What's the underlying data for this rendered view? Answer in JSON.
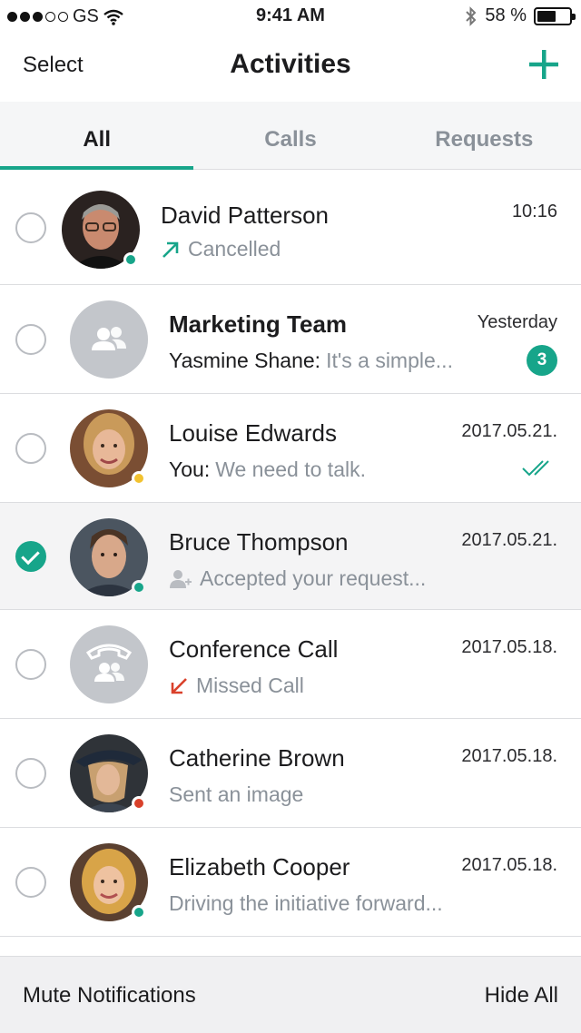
{
  "status_bar": {
    "carrier": "GS",
    "signal_dots_filled": 3,
    "signal_dots_total": 5,
    "time": "9:41 AM",
    "battery": "58 %",
    "battery_level": 0.58,
    "icons": [
      "wifi-icon",
      "bluetooth-icon",
      "battery-icon"
    ]
  },
  "nav": {
    "select_label": "Select",
    "title": "Activities",
    "add_icon": "plus-icon"
  },
  "tabs": [
    {
      "label": "All",
      "active": true
    },
    {
      "label": "Calls",
      "active": false
    },
    {
      "label": "Requests",
      "active": false
    }
  ],
  "colors": {
    "accent": "#17a58a",
    "online": "#17a58a",
    "away": "#f2c230",
    "busy": "#d9412b",
    "missed": "#d9412b"
  },
  "activities": [
    {
      "name": "David Patterson",
      "time": "10:16",
      "status_icon": "outgoing-arrow-icon",
      "status_text": "Cancelled",
      "presence": "online",
      "selected": false
    },
    {
      "name": "Marketing Team",
      "time": "Yesterday",
      "sender": "Yasmine Shane:",
      "message": "It's a simple...",
      "unread": "3",
      "group": true,
      "selected": false
    },
    {
      "name": "Louise Edwards",
      "time": "2017.05.21.",
      "sender": "You:",
      "message": "We need to talk.",
      "read_icon": "double-check-icon",
      "presence": "away",
      "selected": false
    },
    {
      "name": "Bruce Thompson",
      "time": "2017.05.21.",
      "status_icon": "add-contact-icon",
      "status_text": "Accepted your request...",
      "presence": "online",
      "selected": true
    },
    {
      "name": "Conference Call",
      "time": "2017.05.18.",
      "status_icon": "missed-call-arrow-icon",
      "status_text": "Missed Call",
      "group": true,
      "selected": false
    },
    {
      "name": "Catherine Brown",
      "time": "2017.05.18.",
      "status_text": "Sent an image",
      "presence": "busy",
      "selected": false
    },
    {
      "name": "Elizabeth Cooper",
      "time": "2017.05.18.",
      "status_text": "Driving the initiative forward...",
      "presence": "online",
      "selected": false
    }
  ],
  "toolbar": {
    "mute_label": "Mute Notifications",
    "hide_label": "Hide All"
  }
}
